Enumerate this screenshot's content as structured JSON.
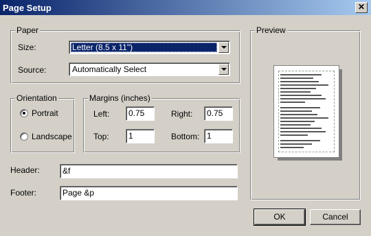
{
  "window": {
    "title": "Page Setup",
    "close_glyph": "✕"
  },
  "paper": {
    "legend": "Paper",
    "size_label": "Size:",
    "size_value": "Letter (8.5 x 11\")",
    "source_label": "Source:",
    "source_value": "Automatically Select"
  },
  "orientation": {
    "legend": "Orientation",
    "portrait": "Portrait",
    "landscape": "Landscape",
    "selected": "Portrait"
  },
  "margins": {
    "legend": "Margins (inches)",
    "left_label": "Left:",
    "left_value": "0.75",
    "right_label": "Right:",
    "right_value": "0.75",
    "top_label": "Top:",
    "top_value": "1",
    "bottom_label": "Bottom:",
    "bottom_value": "1"
  },
  "header": {
    "label": "Header:",
    "value": "&f"
  },
  "footer": {
    "label": "Footer:",
    "value": "Page &p"
  },
  "preview": {
    "legend": "Preview"
  },
  "buttons": {
    "ok": "OK",
    "cancel": "Cancel"
  },
  "colors": {
    "titlebar": "#0a246a",
    "face": "#d4d0c8",
    "selection": "#0a246a"
  }
}
